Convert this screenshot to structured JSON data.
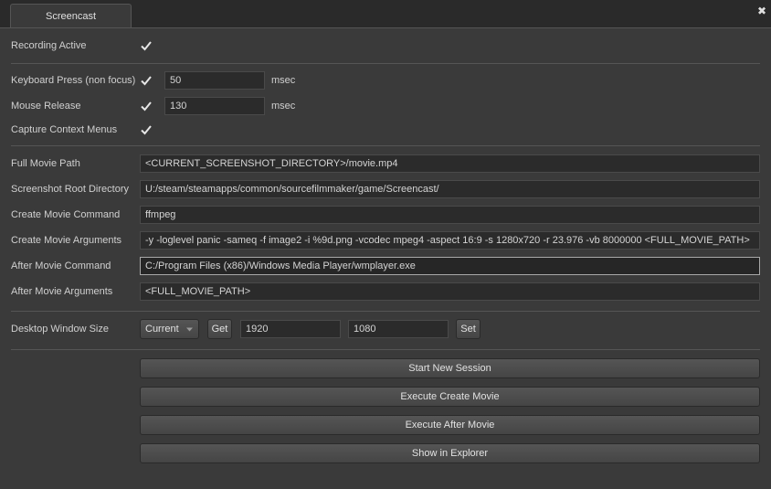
{
  "tab": {
    "label": "Screencast"
  },
  "close_glyph": "✖",
  "recording_active": {
    "label": "Recording Active",
    "checked": true
  },
  "keyboard_press": {
    "label": "Keyboard Press (non focus)",
    "checked": true,
    "value": "50",
    "unit": "msec"
  },
  "mouse_release": {
    "label": "Mouse Release",
    "checked": true,
    "value": "130",
    "unit": "msec"
  },
  "capture_context_menus": {
    "label": "Capture Context Menus",
    "checked": true
  },
  "full_movie_path": {
    "label": "Full Movie Path",
    "value": "<CURRENT_SCREENSHOT_DIRECTORY>/movie.mp4"
  },
  "screenshot_root_directory": {
    "label": "Screenshot Root Directory",
    "value": "U:/steam/steamapps/common/sourcefilmmaker/game/Screencast/"
  },
  "create_movie_command": {
    "label": "Create Movie Command",
    "value": "ffmpeg"
  },
  "create_movie_arguments": {
    "label": "Create Movie Arguments",
    "value": "-y -loglevel panic -sameq -f image2 -i %9d.png -vcodec mpeg4 -aspect 16:9 -s 1280x720 -r 23.976 -vb 8000000 <FULL_MOVIE_PATH>"
  },
  "after_movie_command": {
    "label": "After Movie Command",
    "value": "C:/Program Files (x86)/Windows Media Player/wmplayer.exe"
  },
  "after_movie_arguments": {
    "label": "After Movie Arguments",
    "value": "<FULL_MOVIE_PATH>"
  },
  "desktop_window_size": {
    "label": "Desktop Window Size",
    "mode": "Current",
    "get_label": "Get",
    "width": "1920",
    "height": "1080",
    "set_label": "Set"
  },
  "actions": {
    "start_new_session": "Start New Session",
    "execute_create_movie": "Execute Create Movie",
    "execute_after_movie": "Execute After Movie",
    "show_in_explorer": "Show in Explorer"
  },
  "colors": {
    "background": "#3a3a3a",
    "field_background": "#2b2b2b",
    "button": "#4d4d4d",
    "text": "#d4d4d4"
  }
}
